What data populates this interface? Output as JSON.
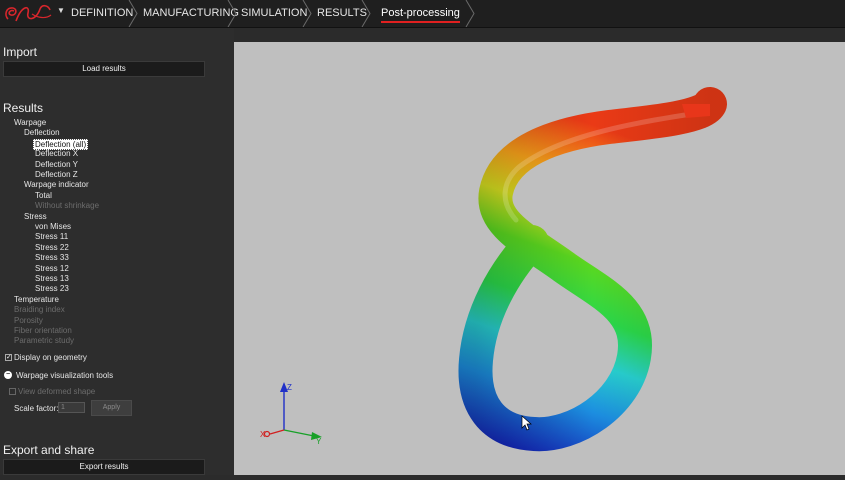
{
  "app": {
    "breadcrumbs": [
      "DEFINITION",
      "MANUFACTURING",
      "SIMULATION",
      "RESULTS",
      "Post-processing"
    ]
  },
  "import": {
    "title": "Import",
    "load_button": "Load results"
  },
  "results": {
    "title": "Results",
    "tree": [
      {
        "label": "Warpage",
        "level": 1,
        "state": "normal"
      },
      {
        "label": "Deflection",
        "level": 2,
        "state": "normal"
      },
      {
        "label": "Deflection (all)",
        "level": 3,
        "state": "selected"
      },
      {
        "label": "Deflection X",
        "level": 3,
        "state": "normal"
      },
      {
        "label": "Deflection Y",
        "level": 3,
        "state": "normal"
      },
      {
        "label": "Deflection Z",
        "level": 3,
        "state": "normal"
      },
      {
        "label": "Warpage indicator",
        "level": 2,
        "state": "normal"
      },
      {
        "label": "Total",
        "level": 3,
        "state": "normal"
      },
      {
        "label": "Without shrinkage",
        "level": 3,
        "state": "disabled"
      },
      {
        "label": "Stress",
        "level": 2,
        "state": "normal"
      },
      {
        "label": "von Mises",
        "level": 3,
        "state": "normal"
      },
      {
        "label": "Stress 11",
        "level": 3,
        "state": "normal"
      },
      {
        "label": "Stress 22",
        "level": 3,
        "state": "normal"
      },
      {
        "label": "Stress 33",
        "level": 3,
        "state": "normal"
      },
      {
        "label": "Stress 12",
        "level": 3,
        "state": "normal"
      },
      {
        "label": "Stress 13",
        "level": 3,
        "state": "normal"
      },
      {
        "label": "Stress 23",
        "level": 3,
        "state": "normal"
      },
      {
        "label": "Temperature",
        "level": 1,
        "state": "normal"
      },
      {
        "label": "Braiding index",
        "level": 1,
        "state": "disabled"
      },
      {
        "label": "Porosity",
        "level": 1,
        "state": "disabled"
      },
      {
        "label": "Fiber orientation",
        "level": 1,
        "state": "disabled"
      },
      {
        "label": "Parametric study",
        "level": 1,
        "state": "disabled"
      }
    ],
    "display_on_geometry": {
      "label": "Display on geometry",
      "checked": true
    },
    "warpage_tools": {
      "label": "Warpage visualization tools",
      "expanded": true
    },
    "view_deformed": {
      "label": "View deformed shape",
      "checked": false,
      "enabled": false
    },
    "scale_factor": {
      "label": "Scale factor:",
      "value": "1"
    },
    "apply_button": "Apply"
  },
  "export": {
    "title": "Export and share",
    "export_button": "Export results"
  },
  "colors": {
    "accent_underline": "#e02020",
    "viewport_background": "#bfbfbf",
    "panel_background": "#2d2d2d"
  }
}
